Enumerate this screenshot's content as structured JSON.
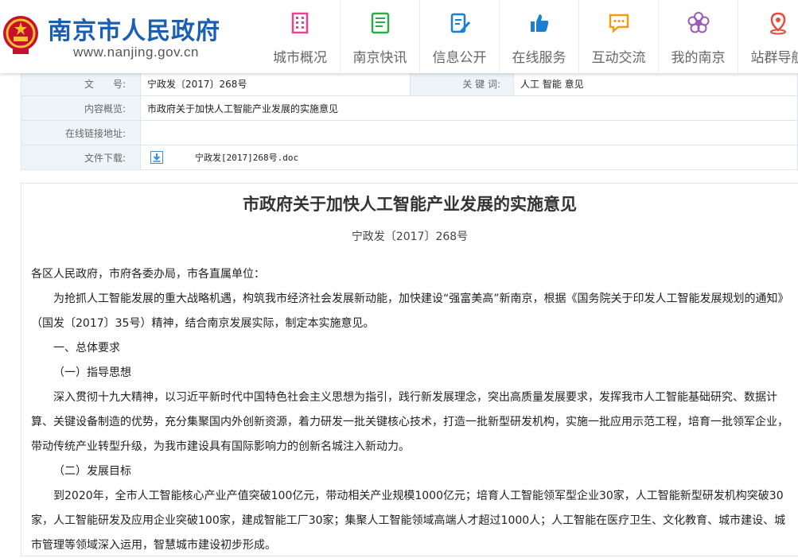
{
  "site": {
    "title": "南京市人民政府",
    "url": "www.nanjing.gov.cn"
  },
  "nav": [
    {
      "label": "城市概况",
      "icon": "building-icon",
      "color": "#e84393"
    },
    {
      "label": "南京快讯",
      "icon": "newspaper-icon",
      "color": "#2eaa4a"
    },
    {
      "label": "信息公开",
      "icon": "document-edit-icon",
      "color": "#1a7fd4"
    },
    {
      "label": "在线服务",
      "icon": "thumbs-up-icon",
      "color": "#1a7fd4"
    },
    {
      "label": "互动交流",
      "icon": "chat-bubble-icon",
      "color": "#f39c12"
    },
    {
      "label": "我的南京",
      "icon": "flower-icon",
      "color": "#9b59b6"
    },
    {
      "label": "站群导航",
      "icon": "location-pin-icon",
      "color": "#e74c3c"
    }
  ],
  "info": {
    "doc_no_label": "文　　号:",
    "doc_no": "宁政发〔2017〕268号",
    "keywords_label": "关 键 词:",
    "keywords": "人工 智能 意见",
    "summary_label": "内容概览:",
    "summary": "市政府关于加快人工智能产业发展的实施意见",
    "link_label": "在线链接地址:",
    "link": "",
    "download_label": "文件下载:",
    "download_file": "宁政发[2017]268号.doc"
  },
  "article": {
    "title": "市政府关于加快人工智能产业发展的实施意见",
    "doc_no": "宁政发〔2017〕268号",
    "paragraphs": [
      "各区人民政府，市府各委办局，市各直属单位：",
      "为抢抓人工智能发展的重大战略机遇，构筑我市经济社会发展新动能，加快建设“强富美高”新南京，根据《国务院关于印发人工智能发展规划的通知》（国发〔2017〕35号）精神，结合南京发展实际，制定本实施意见。",
      "一、总体要求",
      "（一）指导思想",
      "深入贯彻十九大精神，以习近平新时代中国特色社会主义思想为指引，践行新发展理念，突出高质量发展要求，发挥我市人工智能基础研究、数据计算、关键设备制造的优势，充分集聚国内外创新资源，着力研发一批关键核心技术，打造一批新型研发机构，实施一批应用示范工程，培育一批领军企业，带动传统产业转型升级，为我市建设具有国际影响力的创新名城注入新动力。",
      "（二）发展目标",
      "到2020年，全市人工智能核心产业产值突破100亿元，带动相关产业规模1000亿元；培育人工智能领军型企业30家，人工智能新型研发机构突破30家，人工智能研发及应用企业突破100家，建成智能工厂30家；集聚人工智能领域高端人才超过1000人；人工智能在医疗卫生、文化教育、城市建设、城市管理等领域深入运用，智慧城市建设初步形成。"
    ]
  }
}
